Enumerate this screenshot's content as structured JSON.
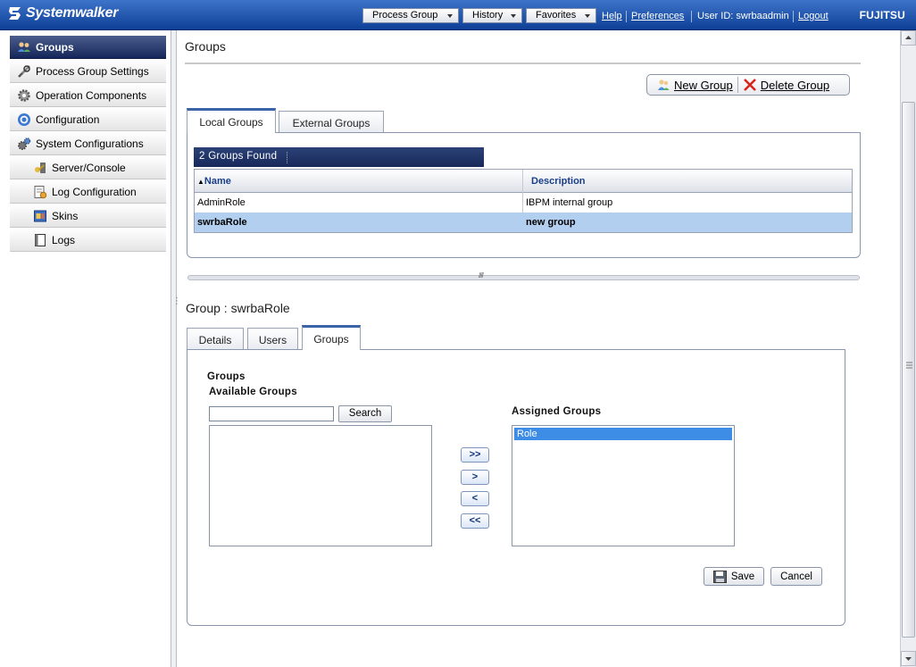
{
  "header": {
    "app_name": "Systemwalker",
    "menus": [
      "Process Group",
      "History",
      "Favorites"
    ],
    "help": "Help",
    "preferences": "Preferences",
    "user": "User ID: swrbaadmin",
    "logout": "Logout",
    "brand": "FUJITSU"
  },
  "sidebar": {
    "items": [
      {
        "label": "Groups",
        "icon": "users-icon"
      },
      {
        "label": "Process Group Settings",
        "icon": "tools-icon"
      },
      {
        "label": "Operation Components",
        "icon": "gear-icon"
      },
      {
        "label": "Configuration",
        "icon": "config-icon"
      },
      {
        "label": "System Configurations",
        "icon": "gears-icon"
      },
      {
        "label": "Server/Console",
        "icon": "server-key-icon"
      },
      {
        "label": "Log Configuration",
        "icon": "log-config-icon"
      },
      {
        "label": "Skins",
        "icon": "skins-icon"
      },
      {
        "label": "Logs",
        "icon": "logs-book-icon"
      }
    ]
  },
  "main": {
    "title": "Groups",
    "actions": {
      "new_group": "New Group",
      "delete_group": "Delete Group"
    },
    "tabs": [
      "Local Groups",
      "External Groups"
    ],
    "found": "2 Groups Found",
    "grid": {
      "columns": [
        "Name",
        "Description"
      ],
      "rows": [
        {
          "name": "AdminRole",
          "description": "IBPM internal group"
        },
        {
          "name": "swrbaRole",
          "description": "new group"
        }
      ]
    }
  },
  "detail": {
    "title": "Group : swrbaRole",
    "tabs": [
      "Details",
      "Users",
      "Groups"
    ],
    "section_label": "Groups",
    "available_label": "Available Groups",
    "search_value": "",
    "search_button": "Search",
    "assigned_label": "Assigned Groups",
    "assigned_items": [
      "Role"
    ],
    "move_buttons": [
      ">>",
      ">",
      "<",
      "<<"
    ],
    "save": "Save",
    "cancel": "Cancel"
  },
  "colors": {
    "header": "#1a4fa8",
    "active_nav": "#1f3266",
    "selected_row": "#b2cff0",
    "grid_header_text": "#1a3e86",
    "list_selection": "#3d8de6"
  }
}
